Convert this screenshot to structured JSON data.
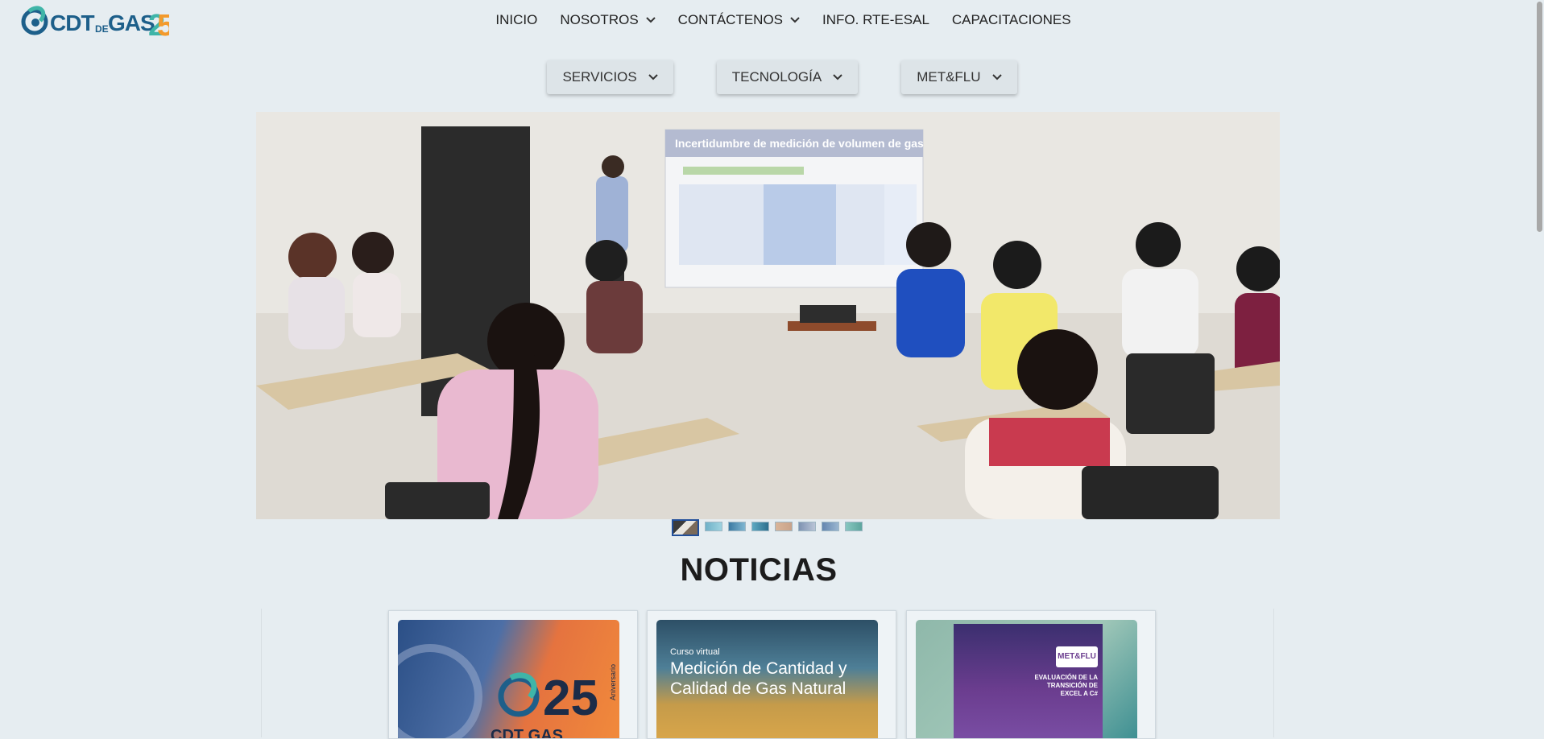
{
  "brand": {
    "logo_text": "CDT DE GAS 25",
    "colors": {
      "primary": "#1d5f8a",
      "accent": "#3fb5a8",
      "orange": "#f39a2c"
    }
  },
  "top_nav": {
    "inicio": "INICIO",
    "nosotros": "NOSOTROS",
    "contactenos": "CONTÁCTENOS",
    "info": "INFO. RTE-ESAL",
    "capacitaciones": "CAPACITACIONES"
  },
  "sub_nav": {
    "servicios": "SERVICIOS",
    "tecnologia": "TECNOLOGÍA",
    "metflu": "MET&FLU"
  },
  "carousel": {
    "slide_title": "Incertidumbre de medición de volumen de gas",
    "slide_count": 8,
    "active_index": 0
  },
  "news": {
    "title": "NOTICIAS",
    "cards": [
      {
        "badge": "25",
        "subtitle": "Aniversario",
        "caption": "CDT GAS"
      },
      {
        "small": "Curso virtual",
        "big": "Medición de Cantidad y Calidad de Gas Natural"
      },
      {
        "brand": "MET&FLU",
        "headline": "EVALUACIÓN DE LA TRANSICIÓN DE EXCEL A C#"
      }
    ]
  }
}
